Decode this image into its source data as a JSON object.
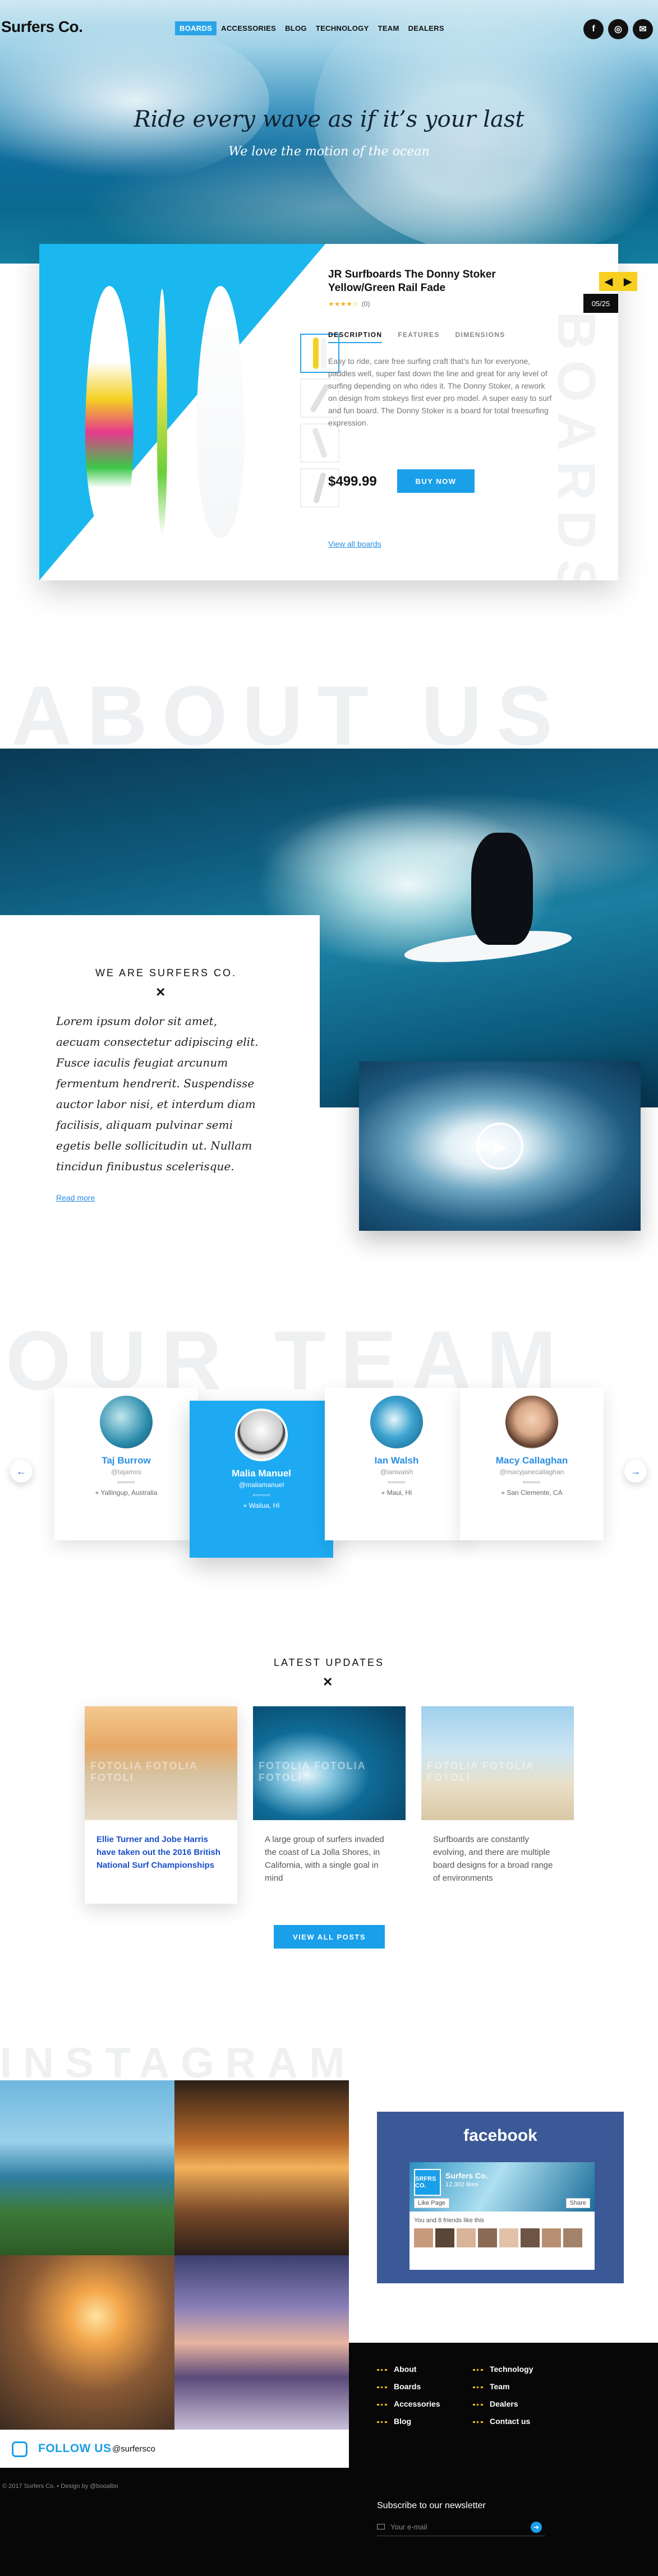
{
  "header": {
    "logo": "Surfers Co.",
    "nav": [
      {
        "label": "BOARDS",
        "active": true
      },
      {
        "label": "ACCESSORIES",
        "active": false
      },
      {
        "label": "BLOG",
        "active": false
      },
      {
        "label": "TECHNOLOGY",
        "active": false
      },
      {
        "label": "TEAM",
        "active": false
      },
      {
        "label": "DEALERS",
        "active": false
      }
    ],
    "social_icons": [
      "facebook-icon",
      "instagram-icon",
      "mail-icon"
    ],
    "social_glyphs": [
      "f",
      "◎",
      "✉"
    ]
  },
  "hero": {
    "title": "Ride every wave as if it’s your last",
    "subtitle": "We love the motion of the ocean"
  },
  "product": {
    "title": "JR Surfboards The Donny Stoker Yellow/Green Rail Fade",
    "stars": "★★★★☆",
    "rating": "(0)",
    "tabs": [
      "DESCRIPTION",
      "FEATURES",
      "DIMENSIONS"
    ],
    "description": "Easy to ride, care free surfing craft that’s fun for everyone, paddles well, super fast down the line and great for any level of surfing depending on who rides it. The Donny Stoker, a rework on design from stokeys first ever pro model. A super easy to surf and fun board. The Donny Stoker is a board for total freesurfing expression.",
    "price": "$499.99",
    "buy_label": "BUY NOW",
    "view_all": "View all boards",
    "counter": "05/25",
    "prev": "◀",
    "next": "▶",
    "side_word": "BOARDS",
    "colors": {
      "accent": "#1ab8ef",
      "button": "#1a9fe9",
      "arrows": "#f7cf1f"
    }
  },
  "about": {
    "bg_word": "ABOUT US",
    "heading": "WE ARE SURFERS CO.",
    "mark": "✕",
    "text": "Lorem ipsum dolor sit amet, aecuam consectetur adipiscing elit. Fusce iaculis feugiat arcunum fermentum hendrerit. Suspendisse auctor labor nisi, et interdum diam facilisis, aliquam pulvinar semi egetis belle sollicitudin ut. Nullam tincidun finibustus scelerisque.",
    "read_more": "Read more",
    "play": "▶"
  },
  "team": {
    "bg_word": "OUR TEAM",
    "prev": "←",
    "next": "→",
    "members": [
      {
        "name": "Taj Burrow",
        "handle": "@tajamos",
        "location": "Yallingup, Australia"
      },
      {
        "name": "Malia Manuel",
        "handle": "@maliamanuel",
        "location": "Wailua, HI"
      },
      {
        "name": "Ian Walsh",
        "handle": "@ianwalsh",
        "location": "Maui, HI"
      },
      {
        "name": "Macy Callaghan",
        "handle": "@macyjanecallaghan",
        "location": "San Clemente, CA"
      }
    ]
  },
  "updates": {
    "heading": "LATEST UPDATES",
    "mark": "✕",
    "watermark": "FOTOLIA  FOTOLIA  FOTOLI",
    "posts": [
      "Ellie Turner and Jobe Harris have taken out the 2016 British National Surf Championships",
      "A large group of surfers invaded the coast of La Jolla Shores, in California, with a single goal in mind",
      "Surfboards are constantly evolving, and there are multiple board designs for a broad range of environments"
    ],
    "button": "VIEW ALL POSTS"
  },
  "instagram": {
    "bg_word": "INSTAGRAM",
    "follow_label": "FOLLOW US",
    "handle": "@surfersco"
  },
  "facebook": {
    "title": "facebook",
    "page_name": "Surfers Co.",
    "likes": "12,302 likes",
    "page_badge": "SRFRS CO.",
    "like_button": "Like Page",
    "share_button": "Share",
    "friends_text": "You and 8 friends like this"
  },
  "footer": {
    "links_left": [
      "About",
      "Boards",
      "Accessories",
      "Blog"
    ],
    "links_right": [
      "Technology",
      "Team",
      "Dealers",
      "Contact us"
    ],
    "copyright": "© 2017 Surfers Co.   •   Design by @booalbo",
    "newsletter_title": "Subscribe to our newsletter",
    "email_placeholder": "Your e-mail",
    "submit": "➜"
  }
}
